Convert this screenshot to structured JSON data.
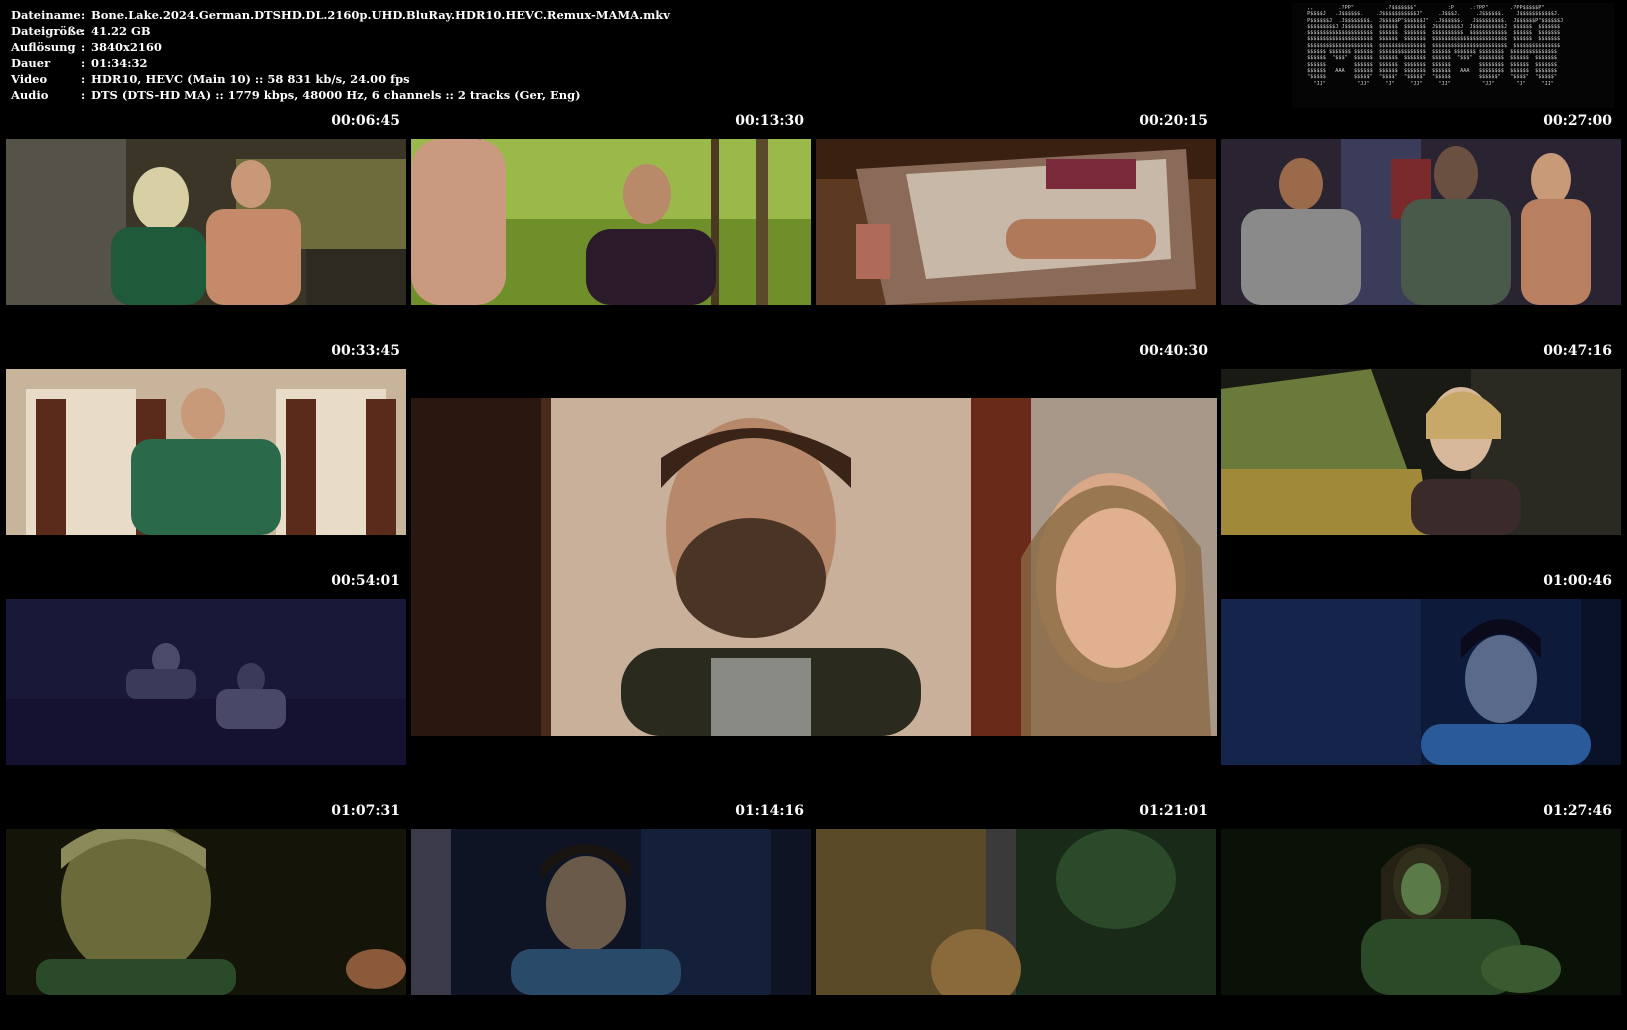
{
  "info": [
    {
      "key": "Dateiname",
      "value": "Bone.Lake.2024.German.DTSHD.DL.2160p.UHD.BluRay.HDR10.HEVC.Remux-MAMA.mkv"
    },
    {
      "key": "Dateigröße",
      "value": "41.22 GB"
    },
    {
      "key": "Auflösung",
      "value": "3840x2160"
    },
    {
      "key": "Dauer",
      "value": "01:34:32"
    },
    {
      "key": "Video",
      "value": "HDR10, HEVC (Main 10) :: 58 831 kb/s, 24.00 fps"
    },
    {
      "key": "Audio",
      "value": "DTS (DTS-HD MA) :: 1779 kbps, 48000 Hz, 6 channels :: 2 tracks (Ger, Eng)"
    }
  ],
  "separator": ":",
  "timestamps": [
    "00:06:45",
    "00:13:30",
    "00:20:15",
    "00:27:00",
    "00:33:45",
    "00:40:30",
    "00:47:16",
    "00:54:01",
    "01:00:46",
    "01:07:31",
    "01:14:16",
    "01:21:01",
    "01:27:46"
  ],
  "scene_icons": [
    "kitchen-scene",
    "forest-scene",
    "suitcase-scene",
    "party-scene",
    "bedroom-scene",
    "couple-scene",
    "car-scene",
    "night-lake-scene",
    "blue-night-scene",
    "green-face-scene",
    "dark-room-scene",
    "doorway-scene",
    "creature-scene"
  ]
}
